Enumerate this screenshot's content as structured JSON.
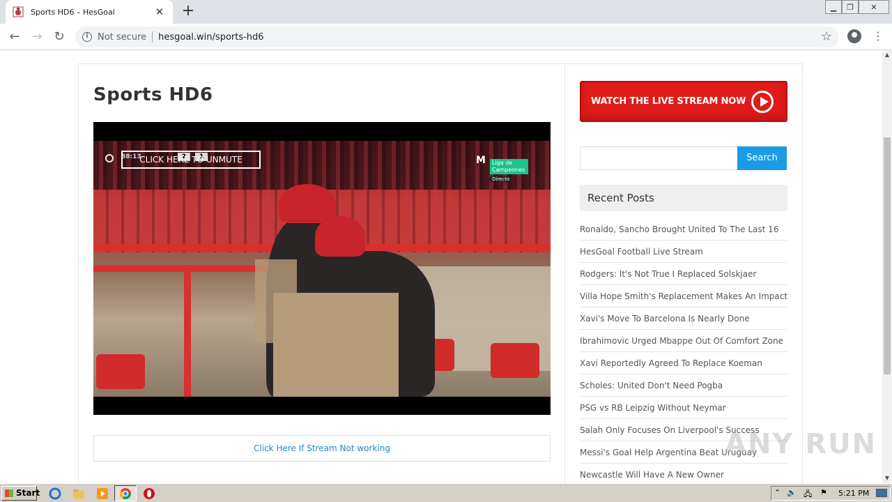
{
  "browser": {
    "tab_title": "Sports HD6 – HesGoal",
    "tab_close": "✕",
    "new_tab": "+",
    "security": "Not secure",
    "url": "hesgoal.win/sports-hd6"
  },
  "page": {
    "title": "Sports HD6",
    "video": {
      "overlay_button": "CLICK HERE TO UNMUTE",
      "clock": "88:13",
      "score_home": "2",
      "score_away": "1",
      "badge_line1": "Liga de",
      "badge_line2": "Campeones",
      "badge_live": "Directo"
    },
    "stream_link": "Click Here If Stream Not working"
  },
  "sidebar": {
    "banner": "WATCH THE LIVE STREAM NOW",
    "search_placeholder": "",
    "search_button": "Search",
    "recent_posts_title": "Recent Posts",
    "recent_posts": [
      "Ronaldo, Sancho Brought United To The Last 16",
      "HesGoal Football Live Stream",
      "Rodgers: It's Not True I Replaced Solskjaer",
      "Villa Hope Smith's Replacement Makes An Impact",
      "Xavi's Move To Barcelona Is Nearly Done",
      "Ibrahimovic Urged Mbappe Out Of Comfort Zone",
      "Xavi Reportedly Agreed To Replace Koeman",
      "Scholes: United Don't Need Pogba",
      "PSG vs RB Leipzig Without Neymar",
      "Salah Only Focuses On Liverpool's Success",
      "Messi's Goal Help Argentina Beat Uruguay",
      "Newcastle Will Have A New Owner"
    ]
  },
  "watermark": "ANY RUN",
  "taskbar": {
    "start": "Start",
    "clock": "5:21 PM"
  },
  "colors": {
    "banner_red": "#e01b1b",
    "search_blue": "#1a9be6",
    "link_blue": "#1e88c8"
  }
}
